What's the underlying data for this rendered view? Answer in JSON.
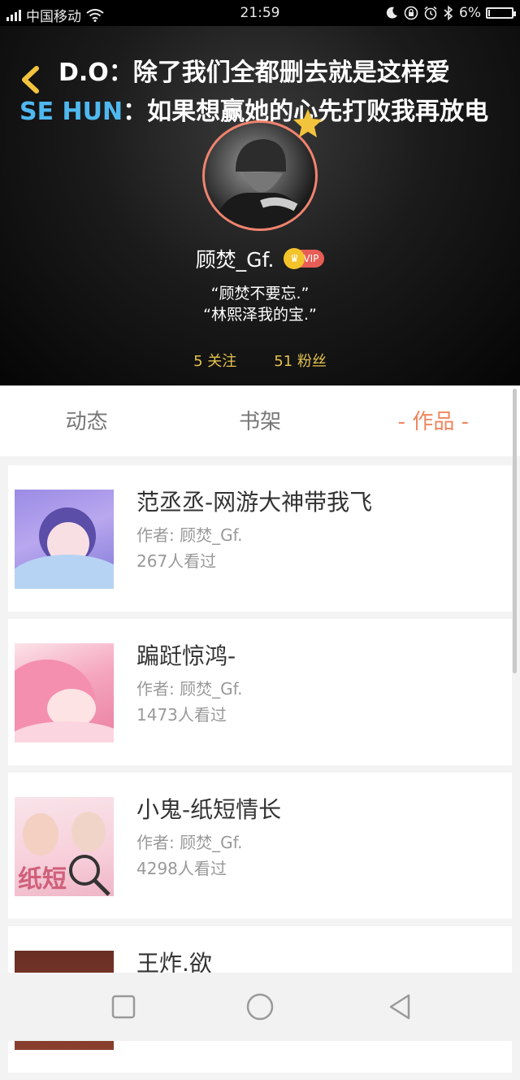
{
  "status_bar": {
    "carrier": "中国移动",
    "time": "21:59",
    "battery": "6%",
    "battery_level": 0.06
  },
  "banner": {
    "line1": "D.O：除了我们全都删去就是这样爱",
    "line2_label": "SE HUN",
    "line2_text": "：如果想赢她的心先打败我再放电"
  },
  "profile": {
    "username": "顾焚_Gf.",
    "vip_badge": "VIP",
    "bio_line1": "“顾焚不要忘.”",
    "bio_line2": "“林熙泽我的宝.”",
    "following": "5 关注",
    "followers": "51 粉丝"
  },
  "tabs": [
    {
      "label": "动态"
    },
    {
      "label": "书架"
    },
    {
      "label": "- 作品 -"
    }
  ],
  "works": [
    {
      "title": "范丞丞-网游大神带我飞",
      "author": "作者: 顾焚_Gf.",
      "views": "267人看过"
    },
    {
      "title": "蹁跹惊鸿-",
      "author": "作者: 顾焚_Gf.",
      "views": "1473人看过"
    },
    {
      "title": "小鬼-纸短情长",
      "author": "作者: 顾焚_Gf.",
      "views": "4298人看过"
    },
    {
      "title": "王炸.欲",
      "author": "",
      "views": ""
    }
  ],
  "colors": {
    "accent": "#f0865d",
    "follow_text": "#e3c14f",
    "banner_label": "#4fb8ef",
    "vip": "#e85d55"
  }
}
